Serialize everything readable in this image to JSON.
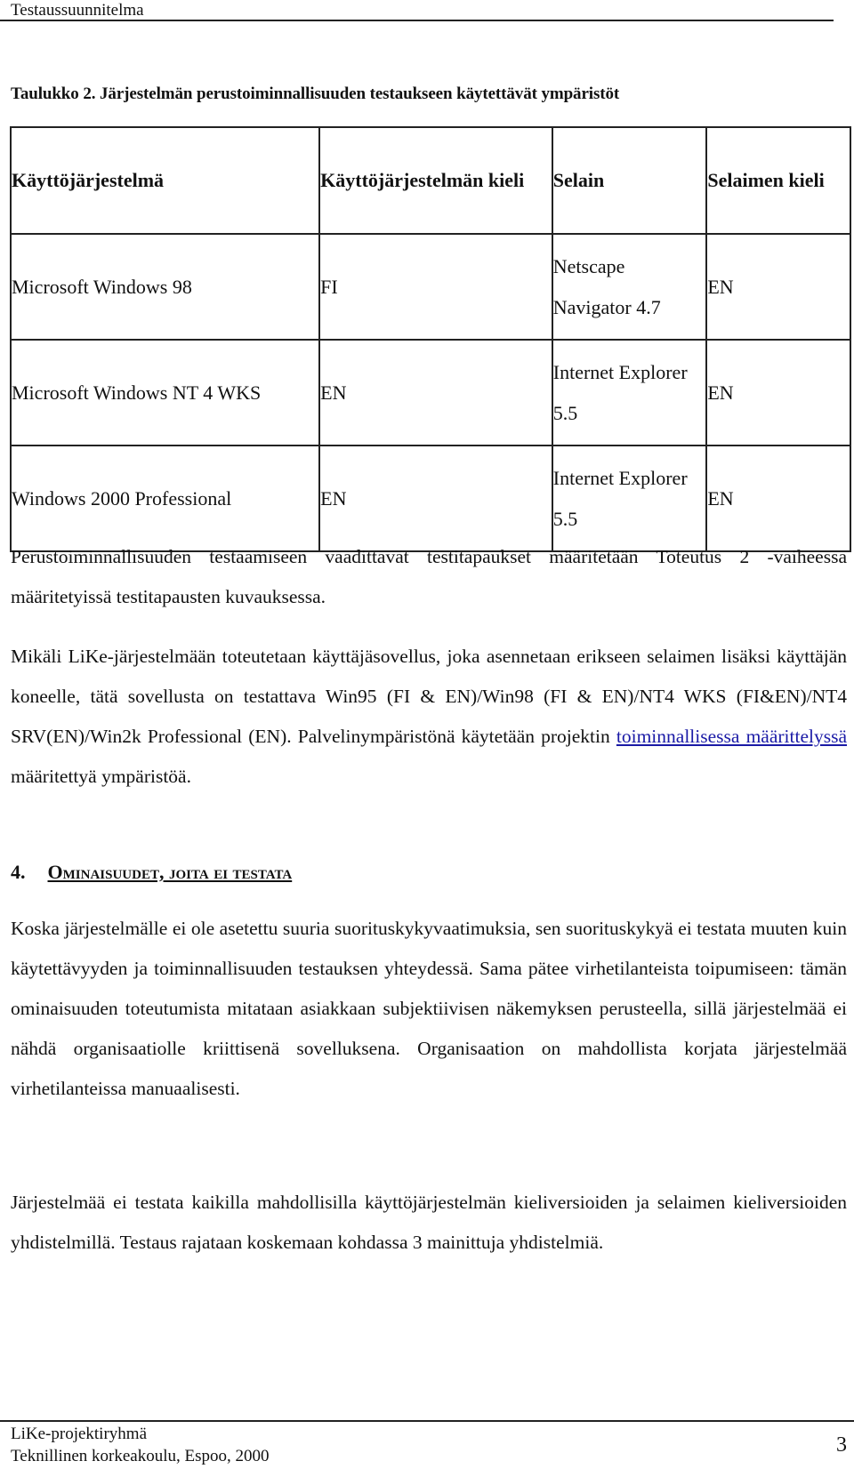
{
  "header": {
    "title": "Testaussuunnitelma"
  },
  "table": {
    "caption": "Taulukko 2.  Järjestelmän perustoiminnallisuuden testaukseen käytettävät ympäristöt",
    "columns": [
      "Käyttöjärjestelmä",
      "Käyttöjärjestelmän kieli",
      "Selain",
      "Selaimen kieli"
    ],
    "rows": [
      [
        "Microsoft Windows 98",
        "FI",
        "Netscape Navigator 4.7",
        "EN"
      ],
      [
        "Microsoft Windows NT 4 WKS",
        "EN",
        "Internet Explorer 5.5",
        "EN"
      ],
      [
        "Windows 2000 Professional",
        "EN",
        "Internet Explorer 5.5",
        "EN"
      ]
    ]
  },
  "paragraphs": {
    "p1": "Perustoiminnallisuuden testaamiseen vaadittavat testitapaukset määritetään Toteutus 2 -vaiheessa määritetyissä testitapausten kuvauksessa.",
    "p2_before_link": "Mikäli LiKe-järjestelmään toteutetaan käyttäjäsovellus, joka asennetaan erikseen selaimen lisäksi käyttäjän koneelle, tätä sovellusta on testattava Win95 (FI & EN)/Win98 (FI & EN)/NT4 WKS (FI&EN)/NT4 SRV(EN)/Win2k Professional (EN).  Palvelinympäristönä käytetään projektin ",
    "p2_link": "toiminnallisessa määrittelyssä",
    "p2_after_link": " määritettyä ympäristöä.",
    "p3": "Koska järjestelmälle ei ole asetettu suuria suorituskykyvaatimuksia, sen suorituskykyä ei testata muuten kuin käytettävyyden ja toiminnallisuuden testauksen yhteydessä.  Sama pätee virhetilanteista toipumiseen: tämän ominaisuuden toteutumista mitataan asiakkaan subjektiivisen näkemyksen perusteella, sillä järjestelmää ei nähdä organisaatiolle kriittisenä sovelluksena.  Organisaation on mahdollista korjata järjestelmää virhetilanteissa manuaalisesti.",
    "p4": "Järjestelmää ei testata kaikilla mahdollisilla käyttöjärjestelmän kieliversioiden ja selaimen kieliversioiden yhdistelmillä. Testaus rajataan koskemaan kohdassa 3 mainittuja yhdistelmiä."
  },
  "section": {
    "number": "4.",
    "title": "Ominaisuudet, joita ei testata"
  },
  "footer": {
    "line1": "LiKe-projektiryhmä",
    "line2": "Teknillinen korkeakoulu, Espoo, 2000",
    "page_number": "3"
  },
  "colors": {
    "link": "#1a1aa6",
    "text": "#111111"
  }
}
